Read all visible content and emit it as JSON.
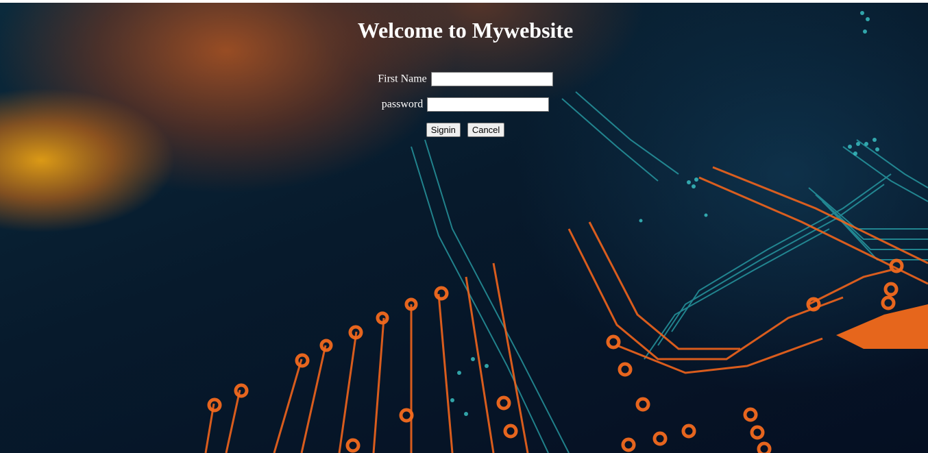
{
  "page": {
    "title": "Welcome to Mywebsite"
  },
  "form": {
    "first_name_label": "First Name",
    "first_name_value": "",
    "password_label": "password",
    "password_value": "",
    "signin_label": "Signin",
    "cancel_label": "Cancel"
  },
  "background": {
    "description_icon": "circuit-board-image",
    "colors": {
      "dark_navy": "#050f22",
      "teal": "#2fb3b8",
      "orange": "#f26a1b",
      "amber": "#e6a014"
    }
  }
}
